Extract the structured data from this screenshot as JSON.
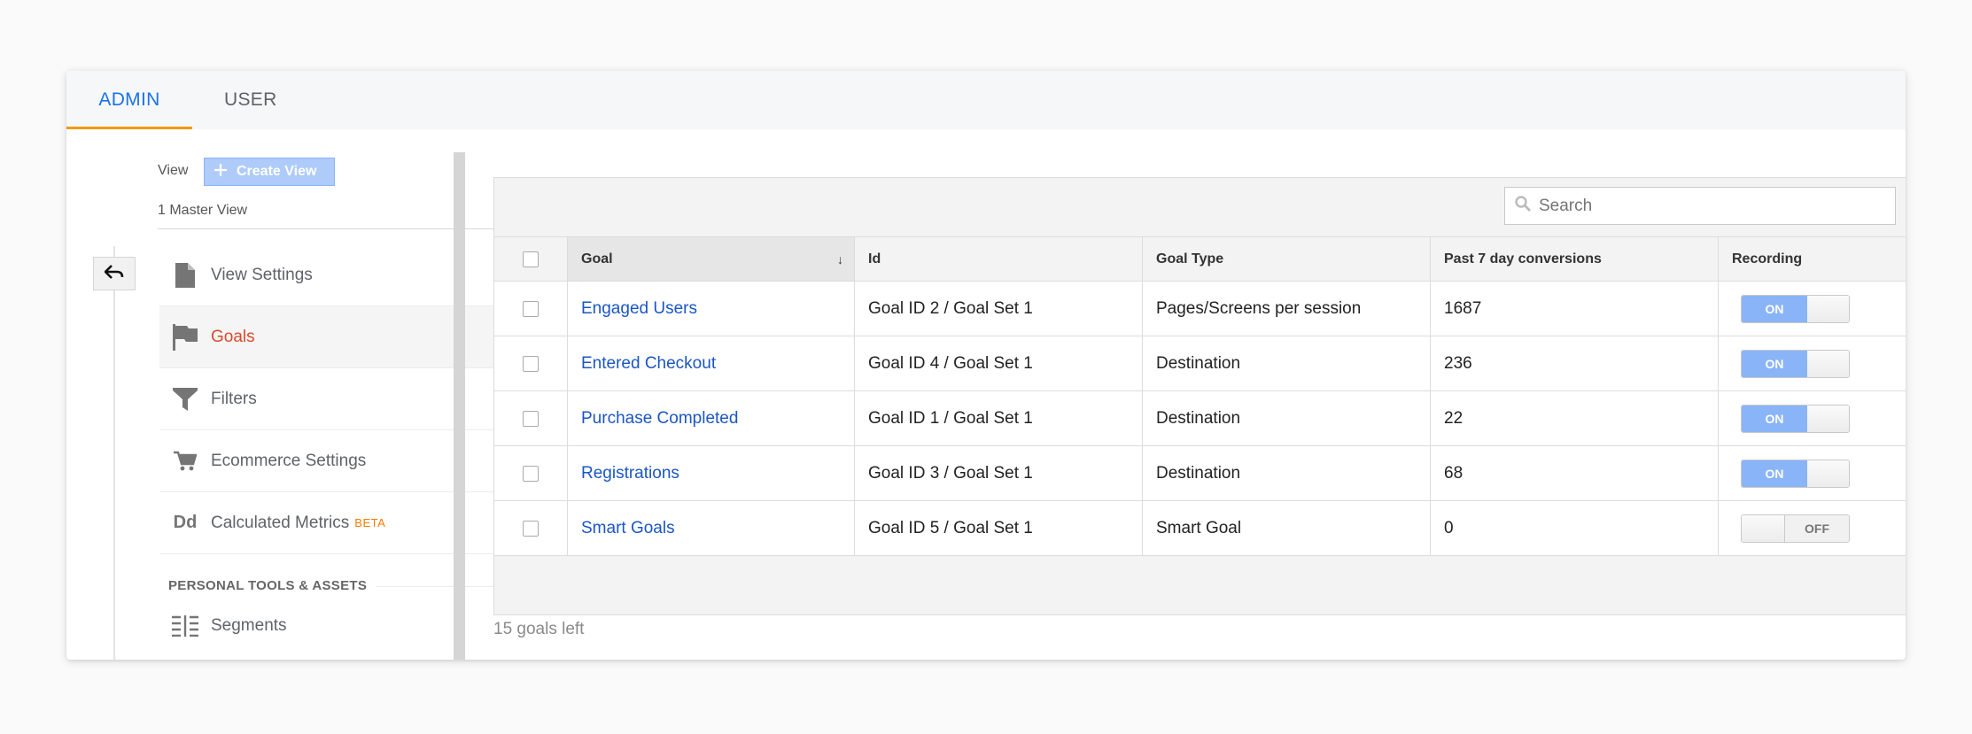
{
  "tabs": [
    {
      "label": "ADMIN",
      "active": true
    },
    {
      "label": "USER",
      "active": false
    }
  ],
  "view": {
    "label": "View",
    "create_button": "Create View",
    "master_view": "1 Master View"
  },
  "nav": {
    "items": [
      {
        "label": "View Settings",
        "icon": "document-icon"
      },
      {
        "label": "Goals",
        "icon": "flag-icon",
        "active": true
      },
      {
        "label": "Filters",
        "icon": "filter-icon"
      },
      {
        "label": "Ecommerce Settings",
        "icon": "cart-icon"
      },
      {
        "label": "Calculated Metrics",
        "icon": "dd-icon",
        "badge": "BETA"
      }
    ],
    "section_label": "PERSONAL TOOLS & ASSETS",
    "segments_label": "Segments",
    "dd_glyph": "Dd"
  },
  "search": {
    "placeholder": "Search"
  },
  "table": {
    "columns": [
      "Goal",
      "Id",
      "Goal Type",
      "Past 7 day conversions",
      "Recording"
    ],
    "sort_indicator": "↓",
    "rows": [
      {
        "goal": "Engaged Users",
        "id": "Goal ID 2 / Goal Set 1",
        "type": "Pages/Screens per session",
        "conversions": "1687",
        "recording": "ON"
      },
      {
        "goal": "Entered Checkout",
        "id": "Goal ID 4 / Goal Set 1",
        "type": "Destination",
        "conversions": "236",
        "recording": "ON"
      },
      {
        "goal": "Purchase Completed",
        "id": "Goal ID 1 / Goal Set 1",
        "type": "Destination",
        "conversions": "22",
        "recording": "ON"
      },
      {
        "goal": "Registrations",
        "id": "Goal ID 3 / Goal Set 1",
        "type": "Destination",
        "conversions": "68",
        "recording": "ON"
      },
      {
        "goal": "Smart Goals",
        "id": "Goal ID 5 / Goal Set 1",
        "type": "Smart Goal",
        "conversions": "0",
        "recording": "OFF"
      }
    ]
  },
  "goals_left": "15 goals left",
  "colors": {
    "accent": "#1a73e8",
    "tab_underline": "#f29900",
    "active_nav": "#d84a2b",
    "toggle_on": "#8ab4f8",
    "beta": "#f57c00"
  }
}
